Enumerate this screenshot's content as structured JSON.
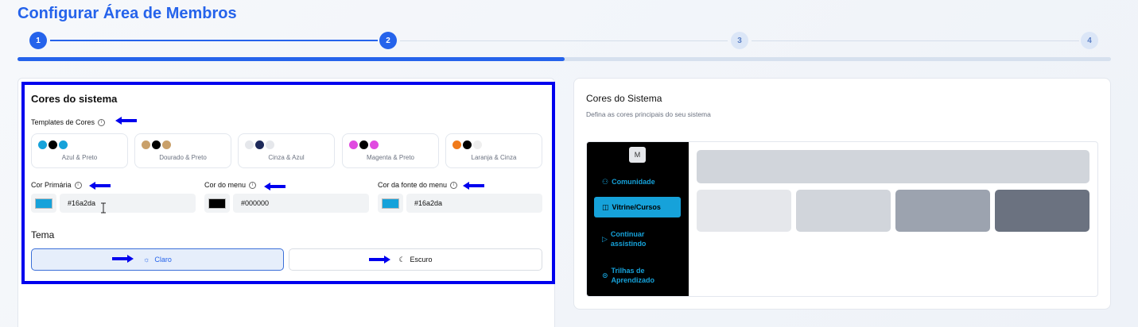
{
  "page": {
    "title": "Configurar Área de Membros"
  },
  "stepper": {
    "steps": [
      "1",
      "2",
      "3",
      "4"
    ],
    "current_step": 2,
    "progress_fraction": 0.5
  },
  "colors_section": {
    "title": "Cores do sistema",
    "templates_label": "Templates de Cores",
    "templates": [
      {
        "name": "Azul & Preto",
        "swatches": [
          "#16a2da",
          "#000000",
          "#16a2da"
        ]
      },
      {
        "name": "Dourado & Preto",
        "swatches": [
          "#c9a06a",
          "#000000",
          "#c9a06a"
        ]
      },
      {
        "name": "Cinza & Azul",
        "swatches": [
          "#e5e7eb",
          "#1e2a5a",
          "#e5e7eb"
        ]
      },
      {
        "name": "Magenta & Preto",
        "swatches": [
          "#e04be0",
          "#000000",
          "#e04be0"
        ]
      },
      {
        "name": "Laranja & Cinza",
        "swatches": [
          "#f07a1a",
          "#000000",
          "#eeeeee"
        ]
      }
    ],
    "primary_color_label": "Cor Primária",
    "primary_color_value": "#16a2da",
    "menu_color_label": "Cor do menu",
    "menu_color_value": "#000000",
    "font_color_label": "Cor da fonte do menu",
    "font_color_value": "#16a2da",
    "theme_label": "Tema",
    "theme_light": "Claro",
    "theme_dark": "Escuro",
    "theme_selected": "Claro"
  },
  "preview_section": {
    "title": "Cores do Sistema",
    "subtitle": "Defina as cores principais do seu sistema",
    "avatar_letter": "M",
    "nav": [
      {
        "label": "Comunidade",
        "icon": "users-icon"
      },
      {
        "label": "Vitrine/Cursos",
        "icon": "book-icon"
      },
      {
        "label": "Continuar assistindo",
        "icon": "play-icon"
      },
      {
        "label": "Trilhas de Aprendizado",
        "icon": "map-pin-icon"
      }
    ]
  },
  "colors": {
    "accent": "#2563eb",
    "annotation": "#0000ee",
    "preview_primary": "#16a2da",
    "preview_menu": "#000000"
  }
}
